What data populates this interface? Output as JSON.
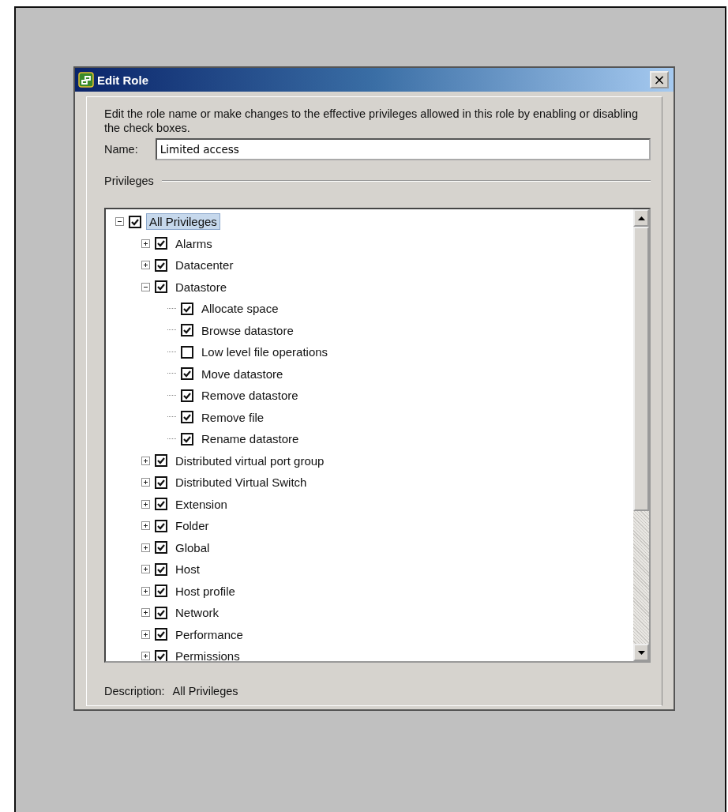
{
  "window": {
    "title": "Edit Role",
    "close": "×"
  },
  "intro": "Edit the role name or make changes to the effective privileges allowed in this role by enabling or disabling the check boxes.",
  "name_field": {
    "label": "Name:",
    "value": "Limited access"
  },
  "privileges_label": "Privileges",
  "tree": [
    {
      "label": "All Privileges",
      "checked": true,
      "selected": true,
      "expanded": true,
      "children": [
        {
          "label": "Alarms",
          "checked": true,
          "selected": false,
          "expanded": false
        },
        {
          "label": "Datacenter",
          "checked": true,
          "selected": false,
          "expanded": false
        },
        {
          "label": "Datastore",
          "checked": true,
          "selected": false,
          "expanded": true,
          "children": [
            {
              "label": "Allocate space",
              "checked": true,
              "selected": false
            },
            {
              "label": "Browse datastore",
              "checked": true,
              "selected": false
            },
            {
              "label": "Low level file operations",
              "checked": false,
              "selected": false
            },
            {
              "label": "Move datastore",
              "checked": true,
              "selected": false
            },
            {
              "label": "Remove datastore",
              "checked": true,
              "selected": false
            },
            {
              "label": "Remove file",
              "checked": true,
              "selected": false
            },
            {
              "label": "Rename datastore",
              "checked": true,
              "selected": false
            }
          ]
        },
        {
          "label": "Distributed virtual port group",
          "checked": true,
          "selected": false,
          "expanded": false
        },
        {
          "label": "Distributed Virtual Switch",
          "checked": true,
          "selected": false,
          "expanded": false
        },
        {
          "label": "Extension",
          "checked": true,
          "selected": false,
          "expanded": false
        },
        {
          "label": "Folder",
          "checked": true,
          "selected": false,
          "expanded": false
        },
        {
          "label": "Global",
          "checked": true,
          "selected": false,
          "expanded": false
        },
        {
          "label": "Host",
          "checked": true,
          "selected": false,
          "expanded": false
        },
        {
          "label": "Host profile",
          "checked": true,
          "selected": false,
          "expanded": false
        },
        {
          "label": "Network",
          "checked": true,
          "selected": false,
          "expanded": false
        },
        {
          "label": "Performance",
          "checked": true,
          "selected": false,
          "expanded": false
        },
        {
          "label": "Permissions",
          "checked": true,
          "selected": false,
          "expanded": false
        }
      ]
    }
  ],
  "description": {
    "label": "Description:",
    "value": "All Privileges"
  }
}
